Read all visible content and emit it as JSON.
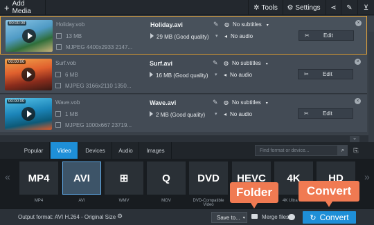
{
  "toolbar": {
    "add_media_label": "Add Media",
    "tools_label": "Tools",
    "settings_label": "Settings"
  },
  "files": [
    {
      "duration": "00:00:00",
      "source_name": "Holiday.vob",
      "source_size": "13 MB",
      "source_meta": "MJPEG 4400x2933 2147...",
      "output_name": "Holiday.avi",
      "output_size": "29 MB (Good quality)",
      "subtitles": "No subtitles",
      "audio": "No audio",
      "edit_label": "Edit",
      "selected": true
    },
    {
      "duration": "00:00:00",
      "source_name": "Surf.vob",
      "source_size": "6 MB",
      "source_meta": "MJPEG 3166x2110 1350...",
      "output_name": "Surf.avi",
      "output_size": "16 MB (Good quality)",
      "subtitles": "No subtitles",
      "audio": "No audio",
      "edit_label": "Edit",
      "selected": false
    },
    {
      "duration": "00:00:00",
      "source_name": "Wave.vob",
      "source_size": "1 MB",
      "source_meta": "MJPEG 1000x667 23719...",
      "output_name": "Wave.avi",
      "output_size": "2 MB (Good quality)",
      "subtitles": "No subtitles",
      "audio": "No audio",
      "edit_label": "Edit",
      "selected": false
    }
  ],
  "format_tabs": [
    "Popular",
    "Video",
    "Devices",
    "Audio",
    "Images"
  ],
  "active_tab": "Video",
  "search_placeholder": "Find format or device...",
  "formats": [
    {
      "icon_text": "MP4",
      "label": "MP4"
    },
    {
      "icon_text": "AVI",
      "label": "AVI"
    },
    {
      "icon_text": "⊞",
      "label": "WMV"
    },
    {
      "icon_text": "Q",
      "label": "MOV"
    },
    {
      "icon_text": "DVD",
      "label": "DVD-Compatible Video"
    },
    {
      "icon_text": "HEVC",
      "label": "HEVC"
    },
    {
      "icon_text": "4K",
      "label": "4K Ultra HD"
    },
    {
      "icon_text": "HD",
      "label": "HD"
    }
  ],
  "selected_format": "AVI",
  "bottom": {
    "output_format": "Output format: AVI H.264 - Original Size",
    "save_to_label": "Save to...",
    "merge_label": "Merge files:",
    "convert_label": "Convert"
  },
  "callouts": {
    "folder": "Folder",
    "convert": "Convert"
  },
  "colors": {
    "accent_blue": "#1e8fd8",
    "callout_orange": "#f07a52",
    "selection_border": "#e6a53a"
  }
}
